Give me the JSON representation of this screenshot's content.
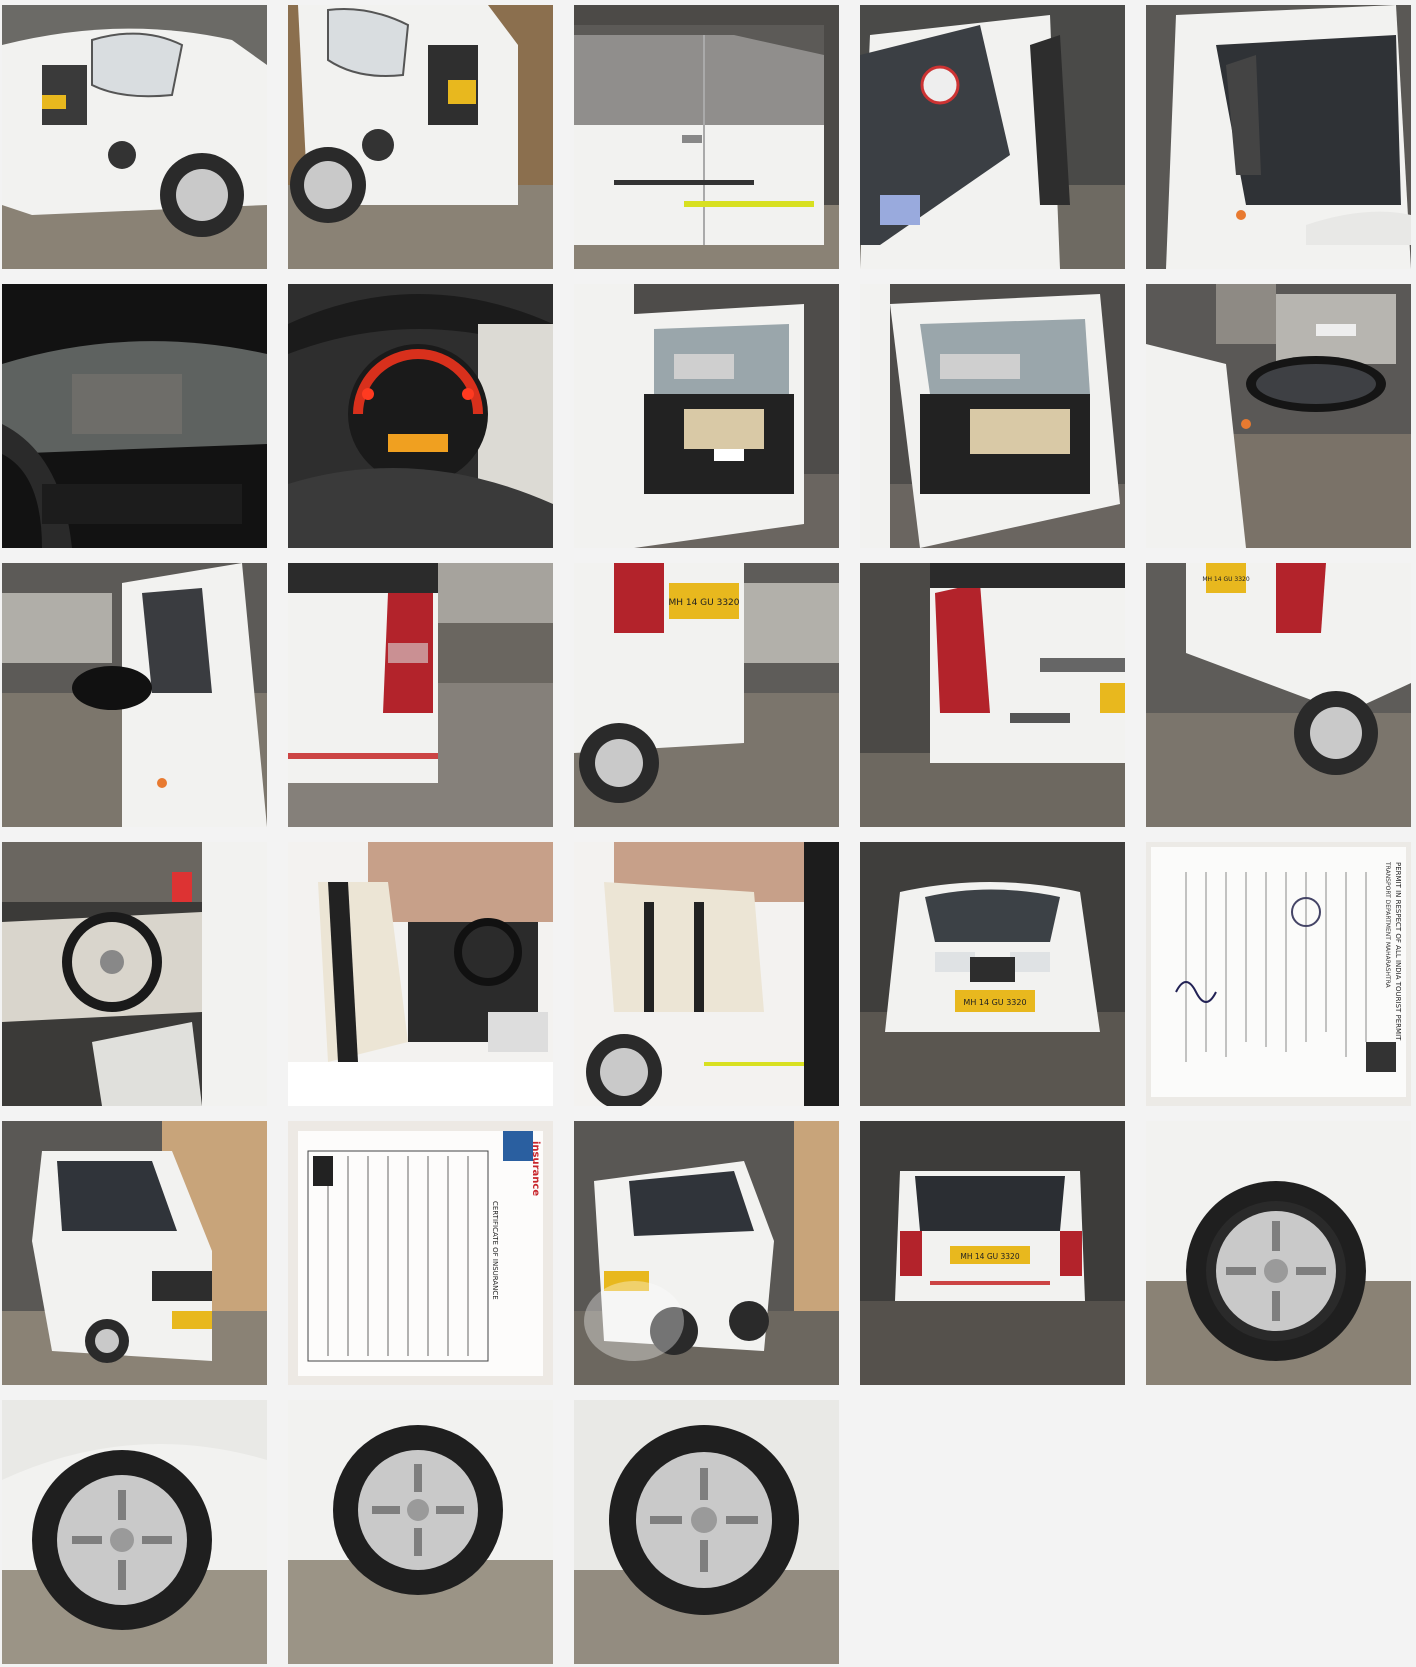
{
  "gallery": {
    "thumbnails": [
      {
        "index": 1,
        "subject": "front-left-headlight"
      },
      {
        "index": 2,
        "subject": "front-right-bumper"
      },
      {
        "index": 3,
        "subject": "side-doors-left"
      },
      {
        "index": 4,
        "subject": "front-windshield-side"
      },
      {
        "index": 5,
        "subject": "rear-quarter-window"
      },
      {
        "index": 6,
        "subject": "dashboard-dark-underside"
      },
      {
        "index": 7,
        "subject": "instrument-cluster"
      },
      {
        "index": 8,
        "subject": "front-door-open"
      },
      {
        "index": 9,
        "subject": "rear-door-open"
      },
      {
        "index": 10,
        "subject": "side-mirror"
      },
      {
        "index": 11,
        "subject": "side-mirror-left"
      },
      {
        "index": 12,
        "subject": "rear-taillight-left"
      },
      {
        "index": 13,
        "subject": "rear-corner-plate"
      },
      {
        "index": 14,
        "subject": "rear-taillight-badge"
      },
      {
        "index": 15,
        "subject": "rear-right-plate"
      },
      {
        "index": 16,
        "subject": "interior-steering"
      },
      {
        "index": 17,
        "subject": "interior-front-seats"
      },
      {
        "index": 18,
        "subject": "interior-rear-seats"
      },
      {
        "index": 19,
        "subject": "front-full-view"
      },
      {
        "index": 20,
        "subject": "permit-document"
      },
      {
        "index": 21,
        "subject": "front-left-three-quarter"
      },
      {
        "index": 22,
        "subject": "insurance-document"
      },
      {
        "index": 23,
        "subject": "front-three-quarter-right"
      },
      {
        "index": 24,
        "subject": "rear-full-view"
      },
      {
        "index": 25,
        "subject": "wheel-front-right"
      },
      {
        "index": 26,
        "subject": "wheel-front-left"
      },
      {
        "index": 27,
        "subject": "wheel-rear-left"
      },
      {
        "index": 28,
        "subject": "wheel-rear-right"
      }
    ],
    "plates": {
      "plate_13": "MH 14 GU 3320",
      "plate_15": "MH 14 GU 3320",
      "plate_19": "MH 14 GU 3320",
      "plate_24": "MH 14 GU 3320"
    },
    "documents": {
      "permit_title": "PERMIT IN RESPECT OF ALL INDIA TOURIST PERMIT",
      "permit_sub": "TRANSPORT DEPARTMENT MAHARASHTRA",
      "insurance_brand": "insurance",
      "insurance_heading": "CERTIFICATE OF INSURANCE"
    },
    "colors": {
      "background": "#f3f3f3",
      "car_white": "#f2f2f0",
      "plate_yellow": "#e8b81e",
      "taillight_red": "#b3232b",
      "tire": "#2a2a2a",
      "floor": "#8a8275",
      "garage_dark": "#3b3a38"
    }
  }
}
